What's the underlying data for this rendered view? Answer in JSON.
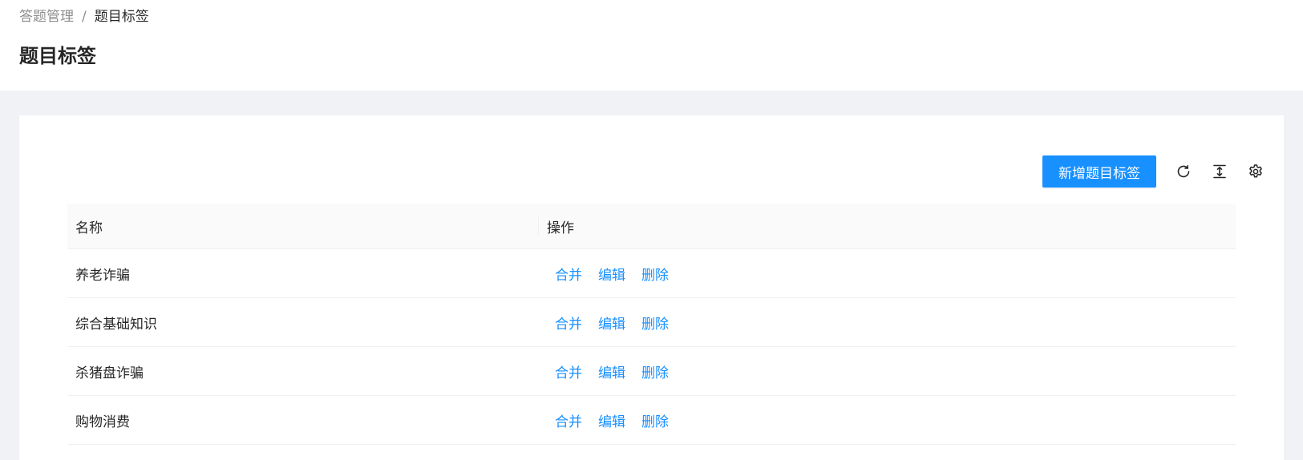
{
  "breadcrumb": {
    "parent": "答题管理",
    "separator": "/",
    "current": "题目标签"
  },
  "page": {
    "title": "题目标签"
  },
  "toolbar": {
    "add_label": "新增题目标签",
    "icons": [
      "reload-icon",
      "column-height-icon",
      "setting-icon"
    ]
  },
  "colors": {
    "primary": "#1890ff",
    "background": "#f0f2f5"
  },
  "table": {
    "columns": [
      "名称",
      "操作"
    ],
    "rows": [
      {
        "name": "养老诈骗",
        "actions": [
          "合并",
          "编辑",
          "删除"
        ]
      },
      {
        "name": "综合基础知识",
        "actions": [
          "合并",
          "编辑",
          "删除"
        ]
      },
      {
        "name": "杀猪盘诈骗",
        "actions": [
          "合并",
          "编辑",
          "删除"
        ]
      },
      {
        "name": "购物消费",
        "actions": [
          "合并",
          "编辑",
          "删除"
        ]
      }
    ]
  }
}
